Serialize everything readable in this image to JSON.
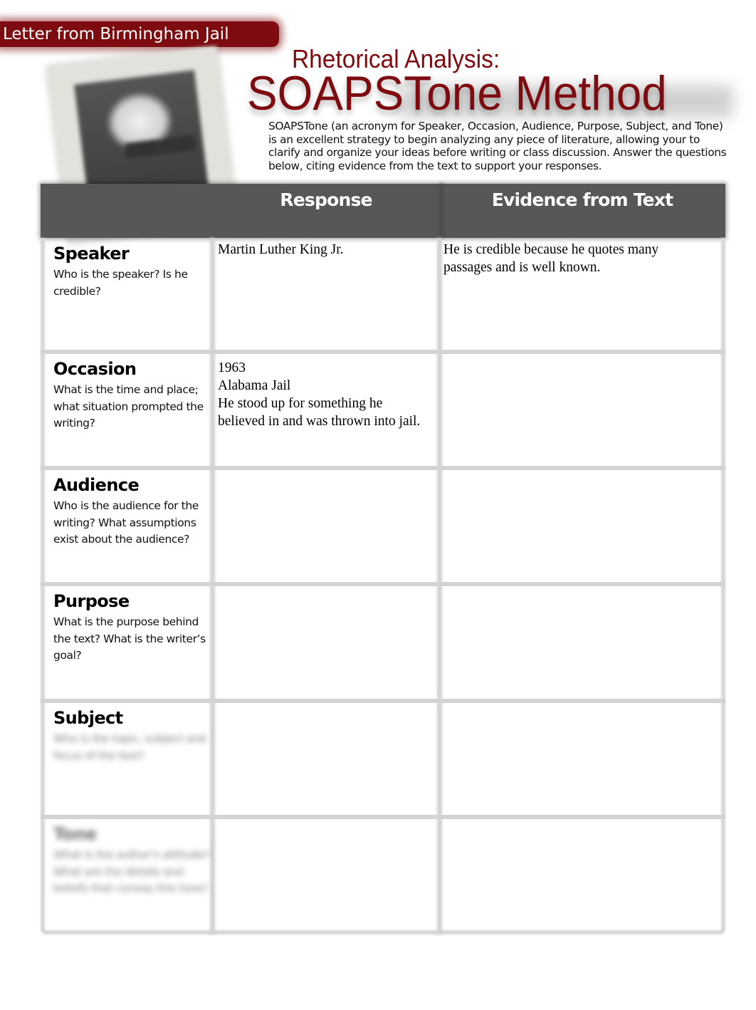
{
  "banner": {
    "text": "Letter from Birmingham Jail",
    "color": "#7e0b0f"
  },
  "header": {
    "subtitle": "Rhetorical Analysis:",
    "title": "SOAPSTone Method",
    "title_color": "#7e0b0f",
    "intro": "SOAPSTone (an acronym for Speaker, Occasion, Audience, Purpose, Subject, and Tone) is an excellent strategy to begin analyzing any piece of literature, allowing your to clarify and organize your ideas before writing or class discussion. Answer the questions below, citing evidence from the text to support your responses."
  },
  "portrait": {
    "description": "Martin Luther King Jr. portrait photo"
  },
  "table": {
    "header_color": "#575757",
    "columns": [
      "",
      "Response",
      "Evidence from Text"
    ],
    "rows": [
      {
        "title": "Speaker",
        "question": "Who is the speaker? Is he credible?",
        "response": "Martin Luther King Jr.",
        "evidence": "He is credible because he quotes many passages and is well known."
      },
      {
        "title": "Occasion",
        "question": "What is the time and place; what situation prompted the writing?",
        "response": "1963\nAlabama Jail\nHe stood up for something he believed in and was thrown into jail.",
        "evidence": ""
      },
      {
        "title": "Audience",
        "question": "Who is the audience for the writing? What assumptions exist about the audience?",
        "response": "",
        "evidence": ""
      },
      {
        "title": "Purpose",
        "question": "What is the purpose behind the text? What is the writer’s goal?",
        "response": "",
        "evidence": ""
      },
      {
        "title": "Subject",
        "question": "[blurred]",
        "response": "",
        "evidence": ""
      },
      {
        "title": "[blurred]",
        "question": "[blurred]",
        "response": "",
        "evidence": ""
      }
    ]
  }
}
